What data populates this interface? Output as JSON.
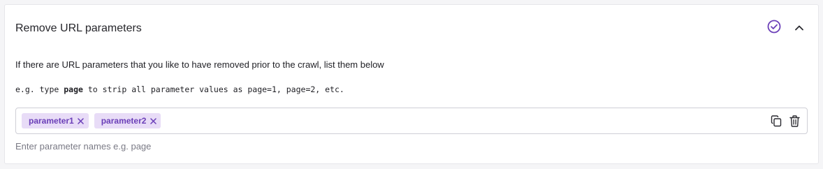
{
  "section": {
    "title": "Remove URL parameters",
    "status_icon": "check-circle-icon",
    "collapse_icon": "chevron-up-icon"
  },
  "description": "If there are URL parameters that you like to have removed prior to the crawl, list them below",
  "example": {
    "prefix": "e.g. type ",
    "keyword": "page",
    "suffix": " to strip all parameter values as page=1, page=2, etc."
  },
  "parameters": [
    {
      "label": "parameter1"
    },
    {
      "label": "parameter2"
    }
  ],
  "field_actions": {
    "copy_icon": "copy-icon",
    "delete_icon": "trash-icon"
  },
  "input": {
    "placeholder": "Enter parameter names e.g. page"
  },
  "colors": {
    "accent": "#6b3fb8",
    "tag_background": "#e8dcf7"
  }
}
